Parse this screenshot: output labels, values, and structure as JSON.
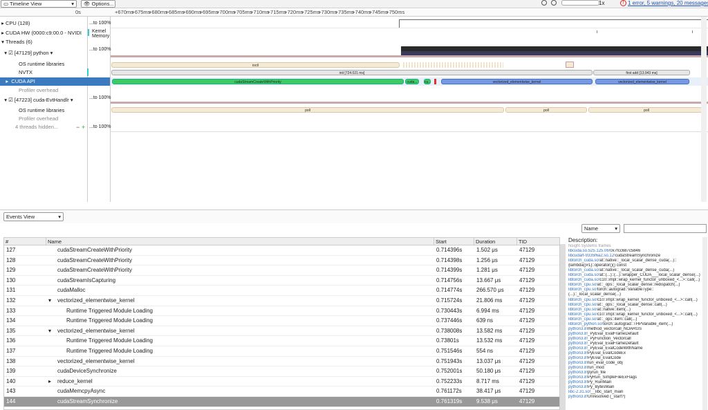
{
  "toolbar": {
    "view_select": "Timeline View",
    "options_label": "Options...",
    "zoom_label": "1x",
    "status_text": "1 error, 5 warnings, 20 messages",
    "error_icon": "!"
  },
  "ruler": {
    "origin": "0s",
    "ticks": [
      "+670ms",
      "+675ms",
      "+680ms",
      "+685ms",
      "+690ms",
      "+695ms",
      "+700ms",
      "+705ms",
      "+710ms",
      "+715ms",
      "+720ms",
      "+725ms",
      "+730ms",
      "+735ms",
      "+740ms",
      "+745ms",
      "+750ms"
    ]
  },
  "tree": {
    "cpu": "CPU (128)",
    "cpu_val": "...to 100%",
    "cudahw": "CUDA HW (0000:c9:00.0 - NVIDI",
    "cudahw_kernel": "Kernel",
    "cudahw_memory": "Memory",
    "threads": "Threads (6)",
    "python": "[47129] python",
    "python_val": "...to 100%",
    "osrt": "OS runtime libraries",
    "nvtx": "NVTX",
    "cudaapi": "CUDA API",
    "profiler": "Profiler overhead",
    "evt": "[47223] cuda-EvtHandlr",
    "evt_val": "...to 100%",
    "osrt2": "OS runtime libraries",
    "profiler2": "Profiler overhead",
    "hidden": "4 threads hidden...",
    "hidden_minus": "−",
    "hidden_plus": "+",
    "hidden_val": "...to 100%"
  },
  "timeline": {
    "ioctl": "ioctl",
    "init": "init [724.021 ms]",
    "first_add": "first add [13.943 ms]",
    "create": "cudaStreamCreateWithPriority",
    "cuda_short": "cuda...",
    "cu_short": "cu...",
    "kernel1": "vectorized_elementwise_kernel",
    "kernel2": "vectorized_elementwise_kernel",
    "poll1": "poll",
    "poll2": "poll",
    "poll3": "poll"
  },
  "events": {
    "view_select": "Events View",
    "filter_select": "Name",
    "search_placeholder": "",
    "columns": [
      "#",
      "Name",
      "Start",
      "Duration",
      "TID"
    ],
    "description_label": "Description:",
    "rows": [
      {
        "n": "127",
        "name": "cudaStreamCreateWithPriority",
        "indent": 1,
        "exp": "",
        "start": "0.714396s",
        "dur": "1.502 μs",
        "tid": "47129"
      },
      {
        "n": "128",
        "name": "cudaStreamCreateWithPriority",
        "indent": 1,
        "exp": "",
        "start": "0.714398s",
        "dur": "1.256 μs",
        "tid": "47129"
      },
      {
        "n": "129",
        "name": "cudaStreamCreateWithPriority",
        "indent": 1,
        "exp": "",
        "start": "0.714399s",
        "dur": "1.281 μs",
        "tid": "47129"
      },
      {
        "n": "130",
        "name": "cudaStreamIsCapturing",
        "indent": 1,
        "exp": "",
        "start": "0.714756s",
        "dur": "13.667 μs",
        "tid": "47129"
      },
      {
        "n": "131",
        "name": "cudaMalloc",
        "indent": 1,
        "exp": "",
        "start": "0.714774s",
        "dur": "266.570 μs",
        "tid": "47129"
      },
      {
        "n": "132",
        "name": "vectorized_elementwise_kernel",
        "indent": 1,
        "exp": "▾",
        "start": "0.715724s",
        "dur": "21.806 ms",
        "tid": "47129"
      },
      {
        "n": "133",
        "name": "Runtime Triggered Module Loading",
        "indent": 2,
        "exp": "",
        "start": "0.730443s",
        "dur": "6.994 ms",
        "tid": "47129"
      },
      {
        "n": "134",
        "name": "Runtime Triggered Module Loading",
        "indent": 2,
        "exp": "",
        "start": "0.737446s",
        "dur": "639 ns",
        "tid": "47129"
      },
      {
        "n": "135",
        "name": "vectorized_elementwise_kernel",
        "indent": 1,
        "exp": "▾",
        "start": "0.738008s",
        "dur": "13.582 ms",
        "tid": "47129"
      },
      {
        "n": "136",
        "name": "Runtime Triggered Module Loading",
        "indent": 2,
        "exp": "",
        "start": "0.73801s",
        "dur": "13.532 ms",
        "tid": "47129"
      },
      {
        "n": "137",
        "name": "Runtime Triggered Module Loading",
        "indent": 2,
        "exp": "",
        "start": "0.751546s",
        "dur": "554 ns",
        "tid": "47129"
      },
      {
        "n": "138",
        "name": "vectorized_elementwise_kernel",
        "indent": 1,
        "exp": "",
        "start": "0.751943s",
        "dur": "13.037 μs",
        "tid": "47129"
      },
      {
        "n": "139",
        "name": "cudaDeviceSynchronize",
        "indent": 1,
        "exp": "",
        "start": "0.752001s",
        "dur": "50.180 μs",
        "tid": "47129"
      },
      {
        "n": "140",
        "name": "reduce_kernel",
        "indent": 1,
        "exp": "▸",
        "start": "0.752233s",
        "dur": "8.717 ms",
        "tid": "47129"
      },
      {
        "n": "143",
        "name": "cudaMemcpyAsync",
        "indent": 1,
        "exp": "",
        "start": "0.761172s",
        "dur": "38.417 μs",
        "tid": "47129"
      },
      {
        "n": "144",
        "name": "cudaStreamSynchronize",
        "indent": 1,
        "exp": "",
        "start": "0.761319s",
        "dur": "9.538 μs",
        "tid": "47129"
      }
    ],
    "desc_lines": [
      [
        "",
        "Nsight Systems frames"
      ],
      [
        "libcuda.so.525.125.06!",
        "0x7fcc687c5846"
      ],
      [
        "libcudart-9335f6a2.so.12!",
        "cudaStreamSynchronize"
      ],
      [
        "libtorch_cuda.so!",
        "at::native::_local_scalar_dense_cuda(...)::"
      ],
      [
        "",
        "{lambda()#1}::operator()() const"
      ],
      [
        "libtorch_cuda.so!",
        "at::native::_local_scalar_dense_cuda(...)"
      ],
      [
        "libtorch_cuda.so!",
        "at::(...)::(...)::wrapper_CUDA___local_scalar_dense(...)"
      ],
      [
        "libtorch_cuda.so!",
        "c10::impl::wrap_kernel_functor_unboxed_<...>::call(...)"
      ],
      [
        "libtorch_cpu.so!",
        "at::_ops::_local_scalar_dense::redispatch(...)"
      ],
      [
        "libtorch_cpu.so!",
        "torch::autograd::VariableType::"
      ],
      [
        "",
        "(...)::_local_scalar_dense(...)"
      ],
      [
        "libtorch_cpu.so!",
        "c10::impl::wrap_kernel_functor_unboxed_<...>::call(...)"
      ],
      [
        "libtorch_cpu.so!",
        "at::_ops::_local_scalar_dense::call(...)"
      ],
      [
        "libtorch_cpu.so!",
        "at::native::item(...)"
      ],
      [
        "libtorch_cpu.so!",
        "c10::impl::wrap_kernel_functor_unboxed_<...>::call(...)"
      ],
      [
        "libtorch_cpu.so!",
        "at::_ops::item::call(...)"
      ],
      [
        "libtorch_python.so!",
        "torch::autograd::THPVariable_item(...)"
      ],
      [
        "python3.8!",
        "method_vectorcall_NOARGS"
      ],
      [
        "python3.8!",
        "_PyEval_EvalFrameDefault"
      ],
      [
        "python3.8!",
        "_PyFunction_Vectorcall"
      ],
      [
        "python3.8!",
        "_PyEval_EvalFrameDefault"
      ],
      [
        "python3.8!",
        "_PyEval_EvalCodeWithName"
      ],
      [
        "python3.8!",
        "PyEval_EvalCodeEx"
      ],
      [
        "python3.8!",
        "PyEval_EvalCode"
      ],
      [
        "python3.8!",
        "run_eval_code_obj"
      ],
      [
        "python3.8!",
        "run_mod"
      ],
      [
        "python3.8!",
        "pyrun_file"
      ],
      [
        "python3.8!",
        "PyRun_SimpleFileExFlags"
      ],
      [
        "python3.8!",
        "Py_RunMain"
      ],
      [
        "python3.8!",
        "Py_BytesMain"
      ],
      [
        "libc-2.31.so!",
        "__libc_start_main"
      ],
      [
        "python3.8!",
        "Unresolved (_start?)"
      ]
    ]
  },
  "colors": {
    "selected_row": "#3c7ac0",
    "green": "#3dcc5c",
    "blue": "#7799e0",
    "beige": "#f5ebd5",
    "error": "#d22"
  }
}
